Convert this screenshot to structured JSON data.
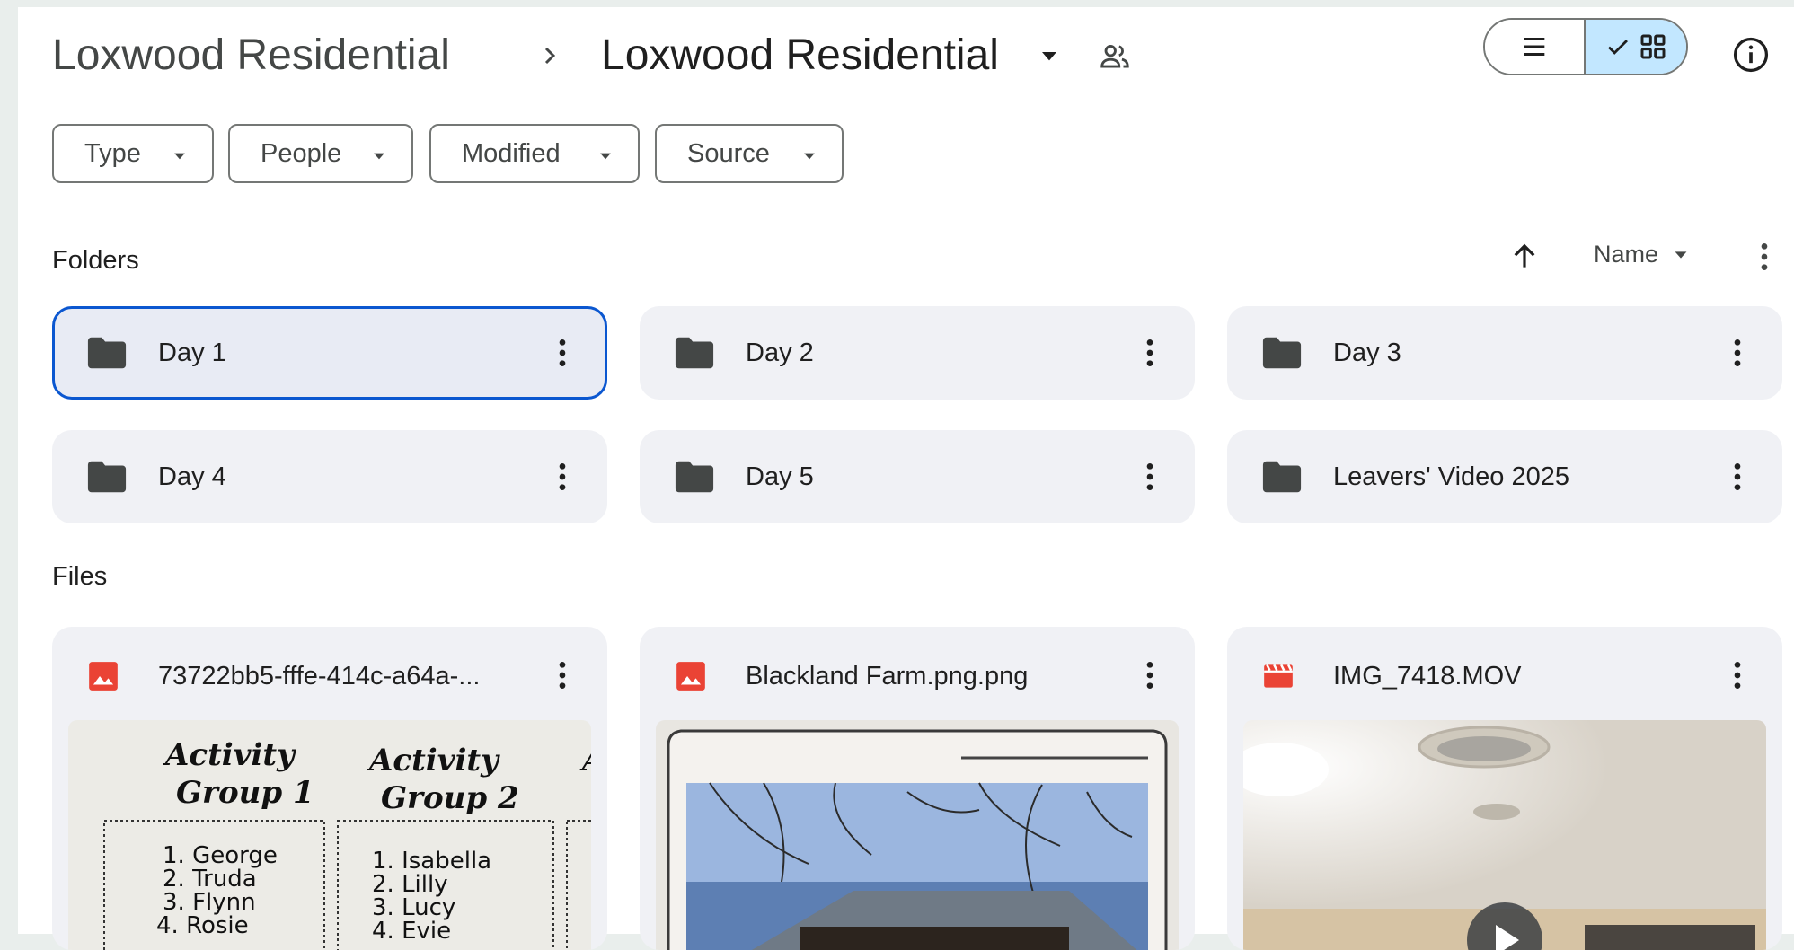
{
  "header": {
    "parent_crumb": "Loxwood Residential",
    "current_title": "Loxwood Residential"
  },
  "icons": {
    "breadcrumb_separator": "chevron-right-icon",
    "title_menu": "caret-down-icon",
    "shared": "people-icon",
    "list_view": "list-icon",
    "grid_view": "grid-icon",
    "info": "info-icon",
    "sort_direction": "arrow-up-icon",
    "more": "more-vert-icon",
    "folder": "folder-icon",
    "image_file": "image-icon",
    "video_file": "video-icon"
  },
  "filters": [
    {
      "label": "Type"
    },
    {
      "label": "People"
    },
    {
      "label": "Modified"
    },
    {
      "label": "Source"
    }
  ],
  "sections": {
    "folders_label": "Folders",
    "files_label": "Files"
  },
  "sort": {
    "field": "Name",
    "direction": "ascending"
  },
  "folders": [
    {
      "name": "Day 1",
      "selected": true
    },
    {
      "name": "Day 2",
      "selected": false
    },
    {
      "name": "Day 3",
      "selected": false
    },
    {
      "name": "Day 4",
      "selected": false
    },
    {
      "name": "Day 5",
      "selected": false
    },
    {
      "name": "Leavers' Video 2025",
      "selected": false
    }
  ],
  "files": [
    {
      "name": "73722bb5-fffe-414c-a64a-...",
      "type": "image",
      "thumbnail_text": {
        "col1_heading_1": "Activity",
        "col1_heading_2": "Group 1",
        "col2_heading_1": "Activity",
        "col2_heading_2": "Group 2",
        "col1_items": [
          "1. George",
          "2. Truda",
          "3. Flynn",
          "4. Rosie"
        ],
        "col2_items": [
          "1. Isabella",
          "2. Lilly",
          "3. Lucy",
          "4. Evie"
        ]
      }
    },
    {
      "name": "Blackland Farm.png.png",
      "type": "image"
    },
    {
      "name": "IMG_7418.MOV",
      "type": "video"
    }
  ],
  "colors": {
    "accent_blue": "#0b57d0",
    "selected_toggle_bg": "#c2e7ff",
    "card_bg": "#f0f1f5",
    "file_icon_red": "#ea4335",
    "folder_icon": "#444746"
  }
}
